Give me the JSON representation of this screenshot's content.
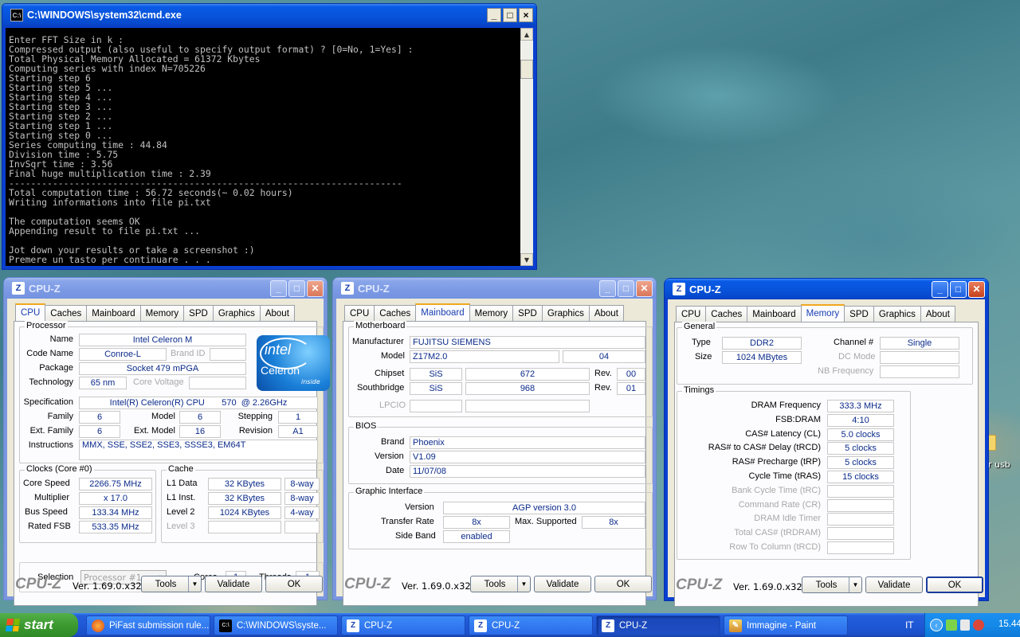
{
  "cmd": {
    "title": "C:\\WINDOWS\\system32\\cmd.exe",
    "lines": [
      "Enter FFT Size in k :",
      "Compressed output (also useful to specify output format) ? [0=No, 1=Yes] :",
      "Total Physical Memory Allocated = 61372 Kbytes",
      "Computing series with index N=705226",
      "Starting step 6",
      "Starting step 5 ...",
      "Starting step 4 ...",
      "Starting step 3 ...",
      "Starting step 2 ...",
      "Starting step 1 ...",
      "Starting step 0 ...",
      "Series computing time : 44.84",
      "Division time : 5.75",
      "InvSqrt time : 3.56",
      "Final huge multiplication time : 2.39",
      "------------------------------------------------------------------------",
      "Total computation time : 56.72 seconds(~ 0.02 hours)",
      "Writing informations into file pi.txt",
      "",
      "The computation seems OK",
      "Appending result to file pi.txt ...",
      "",
      "Jot down your results or take a screenshot :)",
      "Premere un tasto per continuare . . ."
    ]
  },
  "cpuz": {
    "title": "CPU-Z",
    "tabs": [
      "CPU",
      "Caches",
      "Mainboard",
      "Memory",
      "SPD",
      "Graphics",
      "About"
    ],
    "version": "Ver. 1.69.0.x32",
    "logo": "CPU-Z",
    "tools": "Tools",
    "validate": "Validate",
    "ok": "OK"
  },
  "cpu": {
    "processor": "Processor",
    "name_l": "Name",
    "name": "Intel Celeron M",
    "code_l": "Code Name",
    "code": "Conroe-L",
    "brand_l": "Brand ID",
    "package_l": "Package",
    "package": "Socket 479 mPGA",
    "tech_l": "Technology",
    "tech": "65 nm",
    "cv_l": "Core Voltage",
    "spec_l": "Specification",
    "spec": "Intel(R) Celeron(R) CPU       570  @ 2.26GHz",
    "family_l": "Family",
    "family": "6",
    "model_l": "Model",
    "model": "6",
    "stepping_l": "Stepping",
    "stepping": "1",
    "extfam_l": "Ext. Family",
    "extfam": "6",
    "extmod_l": "Ext. Model",
    "extmod": "16",
    "rev_l": "Revision",
    "rev": "A1",
    "instr_l": "Instructions",
    "instr": "MMX, SSE, SSE2, SSE3, SSSE3, EM64T",
    "clocks": "Clocks (Core #0)",
    "cs_l": "Core Speed",
    "cs": "2266.75 MHz",
    "mult_l": "Multiplier",
    "mult": "x 17.0",
    "bus_l": "Bus Speed",
    "bus": "133.34 MHz",
    "fsb_l": "Rated FSB",
    "fsb": "533.35 MHz",
    "cache": "Cache",
    "l1d_l": "L1 Data",
    "l1d": "32 KBytes",
    "l1d_w": "8-way",
    "l1i_l": "L1 Inst.",
    "l1i": "32 KBytes",
    "l1i_w": "8-way",
    "l2_l": "Level 2",
    "l2": "1024 KBytes",
    "l2_w": "4-way",
    "l3_l": "Level 3",
    "sel_l": "Selection",
    "sel": "Processor #1",
    "cores_l": "Cores",
    "cores": "1",
    "threads_l": "Threads",
    "threads": "1",
    "intel1": "intel",
    "intel2": "Celeron",
    "intel3": "inside"
  },
  "mb": {
    "mobo": "Motherboard",
    "man_l": "Manufacturer",
    "man": "FUJITSU SIEMENS",
    "model_l": "Model",
    "model": "Z17M2.0",
    "model_r": "04",
    "chip_l": "Chipset",
    "chip_v": "SiS",
    "chip_m": "672",
    "rev_l": "Rev.",
    "chip_r": "00",
    "sb_l": "Southbridge",
    "sb_v": "SiS",
    "sb_m": "968",
    "sb_r": "01",
    "lpcio_l": "LPCIO",
    "bios": "BIOS",
    "brand_l": "Brand",
    "brand": "Phoenix",
    "ver_l": "Version",
    "ver": "V1.09",
    "date_l": "Date",
    "date": "11/07/08",
    "gi": "Graphic Interface",
    "giv_l": "Version",
    "giv": "AGP version 3.0",
    "tr_l": "Transfer Rate",
    "tr": "8x",
    "ms_l": "Max. Supported",
    "ms": "8x",
    "sideband_l": "Side Band",
    "sideband": "enabled"
  },
  "mem": {
    "general": "General",
    "type_l": "Type",
    "type": "DDR2",
    "ch_l": "Channel #",
    "ch": "Single",
    "size_l": "Size",
    "size": "1024 MBytes",
    "dc_l": "DC Mode",
    "nb_l": "NB Frequency",
    "timings": "Timings",
    "t": [
      [
        "DRAM Frequency",
        "333.3 MHz",
        true
      ],
      [
        "FSB:DRAM",
        "4:10",
        true
      ],
      [
        "CAS# Latency (CL)",
        "5.0 clocks",
        true
      ],
      [
        "RAS# to CAS# Delay (tRCD)",
        "5 clocks",
        true
      ],
      [
        "RAS# Precharge (tRP)",
        "5 clocks",
        true
      ],
      [
        "Cycle Time (tRAS)",
        "15 clocks",
        true
      ],
      [
        "Bank Cycle Time (tRC)",
        "",
        false
      ],
      [
        "Command Rate (CR)",
        "",
        false
      ],
      [
        "DRAM Idle Timer",
        "",
        false
      ],
      [
        "Total CAS# (tRDRAM)",
        "",
        false
      ],
      [
        "Row To Column (tRCD)",
        "",
        false
      ]
    ]
  },
  "desktop": {
    "icon_label": "r usb"
  },
  "taskbar": {
    "start": "start",
    "items": [
      "PiFast submission rule...",
      "C:\\WINDOWS\\syste...",
      "CPU-Z",
      "CPU-Z",
      "CPU-Z",
      "Immagine - Paint"
    ],
    "lang": "IT",
    "clock": "15.44"
  }
}
